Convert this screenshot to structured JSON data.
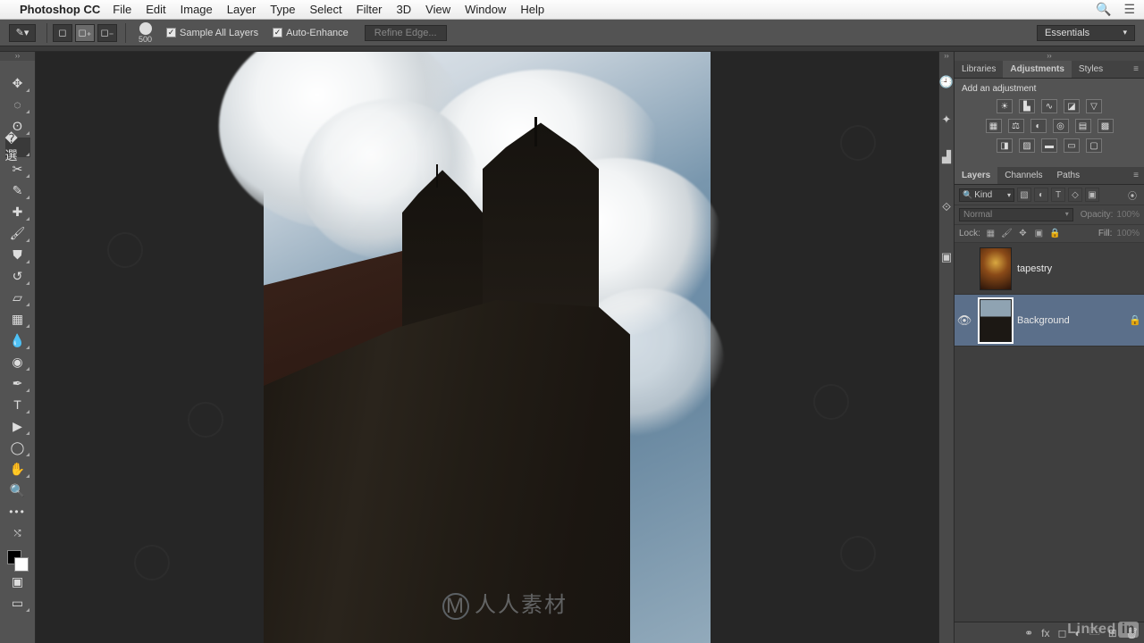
{
  "menubar": {
    "app": "Photoshop CC",
    "items": [
      "File",
      "Edit",
      "Image",
      "Layer",
      "Type",
      "Select",
      "Filter",
      "3D",
      "View",
      "Window",
      "Help"
    ]
  },
  "optbar": {
    "brush_size": "500",
    "sample_all": "Sample All Layers",
    "auto_enhance": "Auto-Enhance",
    "refine_edge": "Refine Edge...",
    "workspace": "Essentials"
  },
  "panels": {
    "adjust_tabs": [
      "Libraries",
      "Adjustments",
      "Styles"
    ],
    "adjust_active": "Adjustments",
    "adjust_title": "Add an adjustment",
    "layers_tabs": [
      "Layers",
      "Channels",
      "Paths"
    ],
    "layers_active": "Layers"
  },
  "layer_controls": {
    "filter_kind": "Kind",
    "blend_mode": "Normal",
    "opacity_label": "Opacity:",
    "opacity_value": "100%",
    "lock_label": "Lock:",
    "fill_label": "Fill:",
    "fill_value": "100%"
  },
  "layers": [
    {
      "name": "tapestry",
      "visible": false,
      "locked": false,
      "selected": false,
      "thumb": "tap"
    },
    {
      "name": "Background",
      "visible": true,
      "locked": true,
      "selected": true,
      "thumb": "bgimg"
    }
  ],
  "watermark": "人人素材",
  "brand_overlay": "Linked"
}
